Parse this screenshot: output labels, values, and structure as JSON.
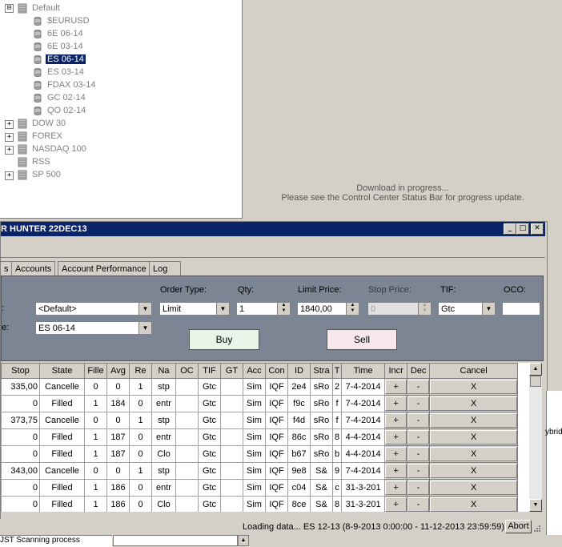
{
  "tree": {
    "root": {
      "label": "Default",
      "expander": "⊟"
    },
    "children": [
      {
        "label": "$EURUSD",
        "selected": false
      },
      {
        "label": "6E 06-14",
        "selected": false
      },
      {
        "label": "6E 03-14",
        "selected": false
      },
      {
        "label": "ES 06-14",
        "selected": true
      },
      {
        "label": "ES 03-14",
        "selected": false
      },
      {
        "label": "FDAX 03-14",
        "selected": false
      },
      {
        "label": "GC 02-14",
        "selected": false
      },
      {
        "label": "QO 02-14",
        "selected": false
      }
    ],
    "groups": [
      {
        "label": "DOW 30",
        "expander": "+"
      },
      {
        "label": "FOREX",
        "expander": "+"
      },
      {
        "label": "NASDAQ 100",
        "expander": "+"
      },
      {
        "label": "RSS",
        "expander": ""
      },
      {
        "label": "SP 500",
        "expander": "+"
      }
    ]
  },
  "download": {
    "line1": "Download in progress...",
    "line2": "Please see the Control Center Status Bar for progress update."
  },
  "window": {
    "title": "R HUNTER 22DEC13",
    "minimize": "_",
    "maximize": "□",
    "close": "✕"
  },
  "tabs": [
    "s",
    "Accounts",
    "Account Performance",
    "Log"
  ],
  "order": {
    "order_type_label": "Order Type:",
    "qty_label": "Qty:",
    "limit_price_label": "Limit Price:",
    "stop_price_label": "Stop Price:",
    "tif_label": "TIF:",
    "oco_label": "OCO:",
    "row1_label_stub": ":",
    "row2_label_stub": "e:",
    "account_value": "<Default>",
    "instrument_value": "ES 06-14",
    "order_type_value": "Limit",
    "qty_value": "1",
    "limit_price_value": "1840,00",
    "stop_price_value": "0",
    "tif_value": "Gtc",
    "oco_value": "",
    "buy_label": "Buy",
    "sell_label": "Sell"
  },
  "grid": {
    "headers": [
      "Stop",
      "State",
      "Fille",
      "Avg",
      "Re",
      "Na",
      "OC",
      "TIF",
      "GT",
      "Acc",
      "Con",
      "ID",
      "Stra",
      "T",
      "Time",
      "Incr",
      "Dec",
      "Cancel"
    ],
    "rows": [
      [
        "335,00",
        "Cancelle",
        "0",
        "0",
        "1",
        "stp",
        "",
        "Gtc",
        "",
        "Sim",
        "IQF",
        "2e4",
        "sRo",
        "2",
        "7-4-2014",
        "+",
        "-",
        "X"
      ],
      [
        "0",
        "Filled",
        "1",
        "184",
        "0",
        "entr",
        "",
        "Gtc",
        "",
        "Sim",
        "IQF",
        "f9c",
        "sRo",
        "f",
        "7-4-2014",
        "+",
        "-",
        "X"
      ],
      [
        "373,75",
        "Cancelle",
        "0",
        "0",
        "1",
        "stp",
        "",
        "Gtc",
        "",
        "Sim",
        "IQF",
        "f4d",
        "sRo",
        "f",
        "7-4-2014",
        "+",
        "-",
        "X"
      ],
      [
        "0",
        "Filled",
        "1",
        "187",
        "0",
        "entr",
        "",
        "Gtc",
        "",
        "Sim",
        "IQF",
        "86c",
        "sRo",
        "8",
        "4-4-2014",
        "+",
        "-",
        "X"
      ],
      [
        "0",
        "Filled",
        "1",
        "187",
        "0",
        "Clo",
        "",
        "Gtc",
        "",
        "Sim",
        "IQF",
        "b67",
        "sRo",
        "b",
        "4-4-2014",
        "+",
        "-",
        "X"
      ],
      [
        "343,00",
        "Cancelle",
        "0",
        "0",
        "1",
        "stp",
        "",
        "Gtc",
        "",
        "Sim",
        "IQF",
        "9e8",
        "S&",
        "9",
        "7-4-2014",
        "+",
        "-",
        "X"
      ],
      [
        "0",
        "Filled",
        "1",
        "186",
        "0",
        "entr",
        "",
        "Gtc",
        "",
        "Sim",
        "IQF",
        "c04",
        "S&",
        "c",
        "31-3-201",
        "+",
        "-",
        "X"
      ],
      [
        "0",
        "Filled",
        "1",
        "186",
        "0",
        "Clo",
        "",
        "Gtc",
        "",
        "Sim",
        "IQF",
        "8ce",
        "S&",
        "8",
        "31-3-201",
        "+",
        "-",
        "X"
      ]
    ]
  },
  "status": {
    "loading_text": "Loading data... ES 12-13  (8-9-2013 0:00:00 - 11-12-2013 23:59:59)",
    "abort_label": "Abort"
  },
  "bottom": {
    "process_text": "JST Scanning process",
    "side_text": "ybrid"
  },
  "colors": {
    "title_bar": "#0a246a",
    "selection": "#0a246a",
    "order_panel": "#7b8593",
    "buy_button": "#e8f4e8",
    "sell_button": "#f8e8ec"
  }
}
